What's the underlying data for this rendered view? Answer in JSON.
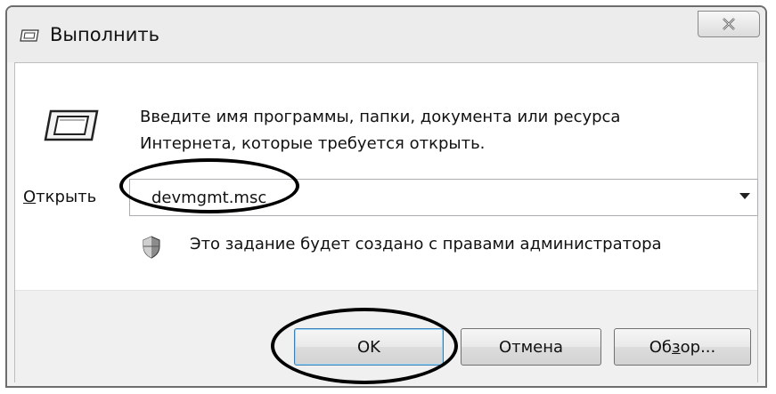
{
  "window": {
    "title": "Выполнить",
    "close_glyph": "☒"
  },
  "description": {
    "line1": "Введите имя программы, папки, документа или ресурса",
    "line2": "Интернета, которые требуется открыть."
  },
  "open_field": {
    "label_accel": "О",
    "label_rest": "ткрыть",
    "value": "devmgmt.msc"
  },
  "admin_note": "Это задание будет создано с правами администратора",
  "buttons": {
    "ok": "OK",
    "cancel": "Отмена",
    "browse_prefix": "Об",
    "browse_accel": "з",
    "browse_suffix": "ор..."
  },
  "icons": {
    "title": "run-icon",
    "large": "run-large-icon",
    "shield": "shield-icon",
    "dropdown": "chevron-down-icon",
    "close": "close-icon"
  }
}
